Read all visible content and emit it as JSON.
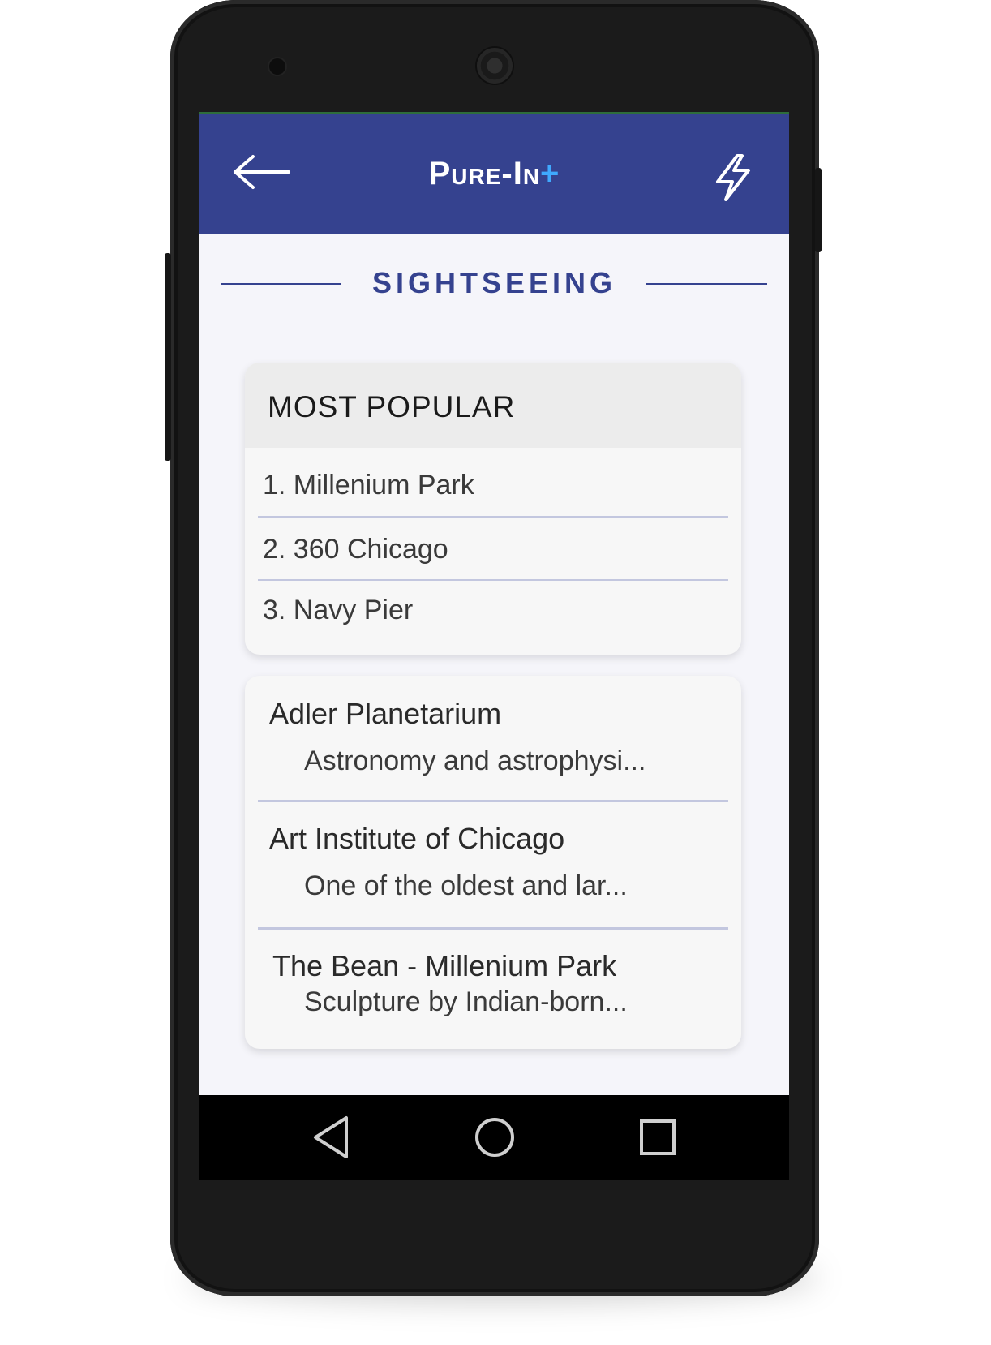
{
  "colors": {
    "header_bg": "#35428f",
    "accent_plus": "#3fa9ff",
    "screen_bg": "#f5f5fa",
    "divider": "#c3c7df"
  },
  "header": {
    "back_icon": "arrow-left-icon",
    "title_main": "Pure-In",
    "title_plus": "+",
    "action_icon": "lightning-bolt-icon"
  },
  "section": {
    "title": "SIGHTSEEING"
  },
  "most_popular": {
    "heading": "MOST POPULAR",
    "items": [
      {
        "label": "1. Millenium Park"
      },
      {
        "label": "2. 360 Chicago"
      },
      {
        "label": "3. Navy Pier"
      }
    ]
  },
  "places": [
    {
      "title": "Adler Planetarium",
      "description": "Astronomy and astrophysi..."
    },
    {
      "title": "Art Institute of Chicago",
      "description": "One of the oldest and lar..."
    },
    {
      "title": "The Bean - Millenium Park",
      "description": "Sculpture by Indian-born..."
    }
  ],
  "android_nav": {
    "back_icon": "nav-back-triangle-icon",
    "home_icon": "nav-home-circle-icon",
    "recents_icon": "nav-recents-square-icon"
  }
}
